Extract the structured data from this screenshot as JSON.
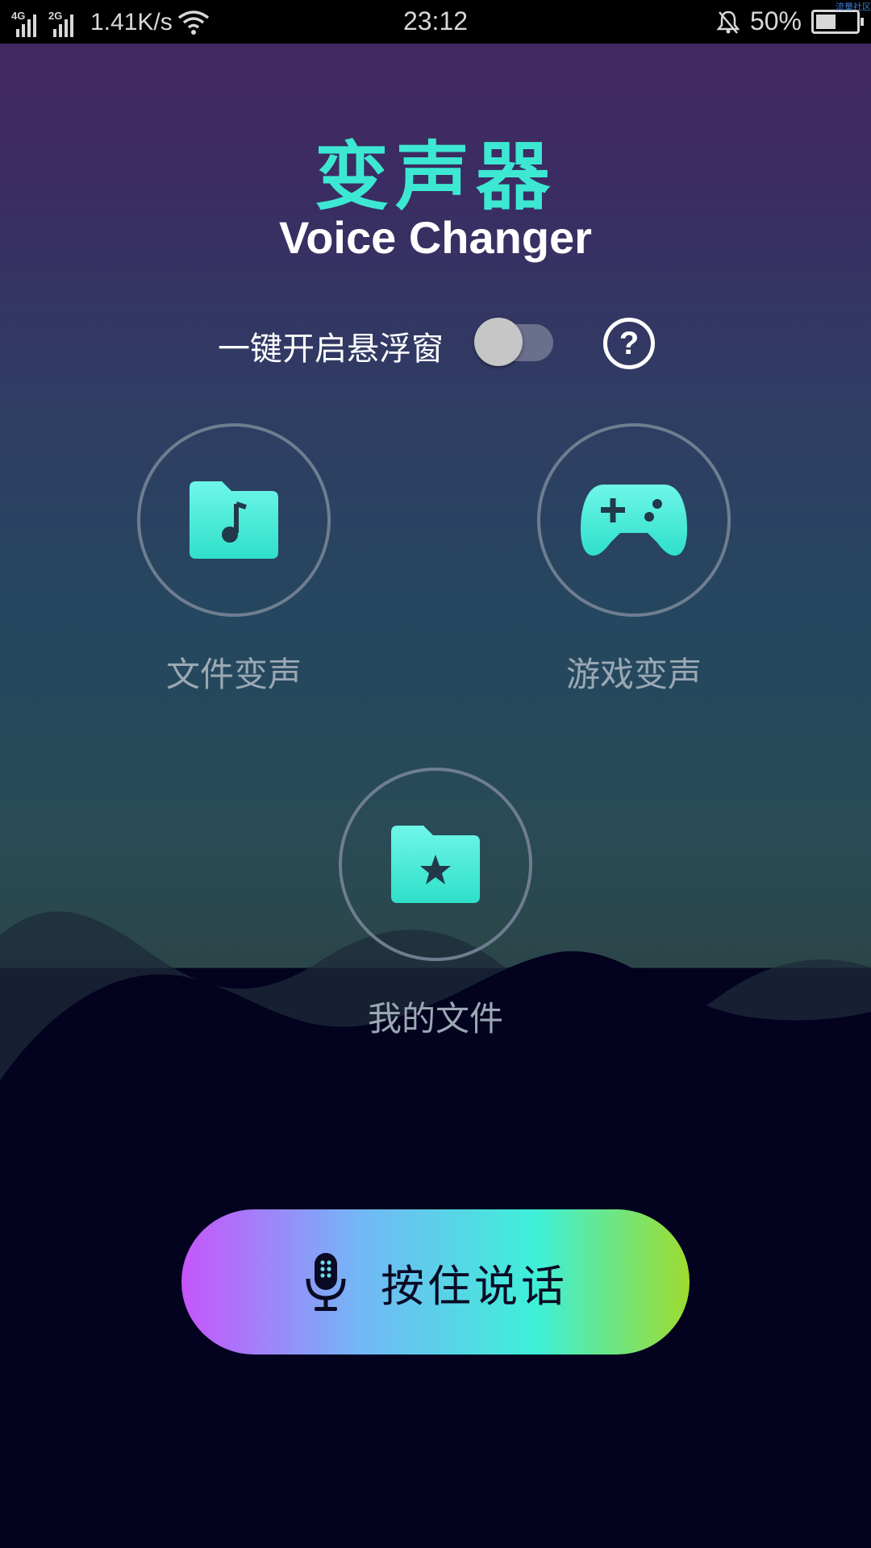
{
  "status_bar": {
    "net1": "4G",
    "net2": "2G",
    "speed": "1.41K/s",
    "time": "23:12",
    "battery": "50%",
    "battery_level": 0.5,
    "corner": "流量社区"
  },
  "header": {
    "title_cn": "变声器",
    "title_en": "Voice Changer"
  },
  "float_window": {
    "label": "一键开启悬浮窗",
    "enabled": false,
    "help_symbol": "?"
  },
  "features": [
    {
      "label": "文件变声",
      "icon": "music-folder-icon"
    },
    {
      "label": "游戏变声",
      "icon": "gamepad-icon"
    },
    {
      "label": "我的文件",
      "icon": "star-folder-icon"
    }
  ],
  "talk_button": {
    "label": "按住说话",
    "icon": "microphone-icon"
  },
  "colors": {
    "accent": "#3de8d3",
    "talk_gradient": [
      "#c655fb",
      "#3ef0d8",
      "#9edb2e"
    ]
  }
}
